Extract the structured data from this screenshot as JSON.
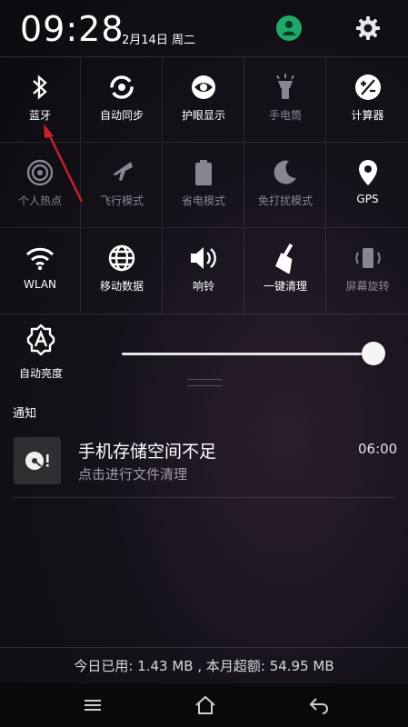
{
  "status": {
    "time": "09:28",
    "date": "2月14日 周二",
    "icons": [
      "user-account-icon",
      "settings-gear-icon"
    ],
    "accent_color": "#1fa968"
  },
  "toggles": [
    {
      "label": "蓝牙",
      "icon": "bluetooth-icon",
      "on": true
    },
    {
      "label": "自动同步",
      "icon": "sync-icon",
      "on": true
    },
    {
      "label": "护眼显示",
      "icon": "eye-icon",
      "on": true
    },
    {
      "label": "手电筒",
      "icon": "flashlight-icon",
      "on": false
    },
    {
      "label": "计算器",
      "icon": "calculator-icon",
      "on": true
    },
    {
      "label": "个人热点",
      "icon": "hotspot-icon",
      "on": false
    },
    {
      "label": "飞行模式",
      "icon": "airplane-icon",
      "on": false
    },
    {
      "label": "省电模式",
      "icon": "battery-icon",
      "on": false
    },
    {
      "label": "免打扰模式",
      "icon": "moon-icon",
      "on": false
    },
    {
      "label": "GPS",
      "icon": "location-pin-icon",
      "on": true
    },
    {
      "label": "WLAN",
      "icon": "wifi-icon",
      "on": true
    },
    {
      "label": "移动数据",
      "icon": "globe-icon",
      "on": true
    },
    {
      "label": "响铃",
      "icon": "speaker-icon",
      "on": true
    },
    {
      "label": "一键清理",
      "icon": "broom-icon",
      "on": true
    },
    {
      "label": "屏幕旋转",
      "icon": "rotate-screen-icon",
      "on": false
    }
  ],
  "brightness": {
    "auto_label": "自动亮度",
    "level": 1.0
  },
  "notifications": {
    "header": "通知",
    "items": [
      {
        "title": "手机存储空间不足",
        "subtitle": "点击进行文件清理",
        "time": "06:00",
        "icon": "storage-warning-icon"
      }
    ]
  },
  "data_usage": "今日已用: 1.43 MB , 本月超额: 54.95 MB",
  "navbar": {
    "icons": [
      "menu-icon",
      "home-icon",
      "back-icon"
    ]
  },
  "annotation_color": "#c8202a"
}
